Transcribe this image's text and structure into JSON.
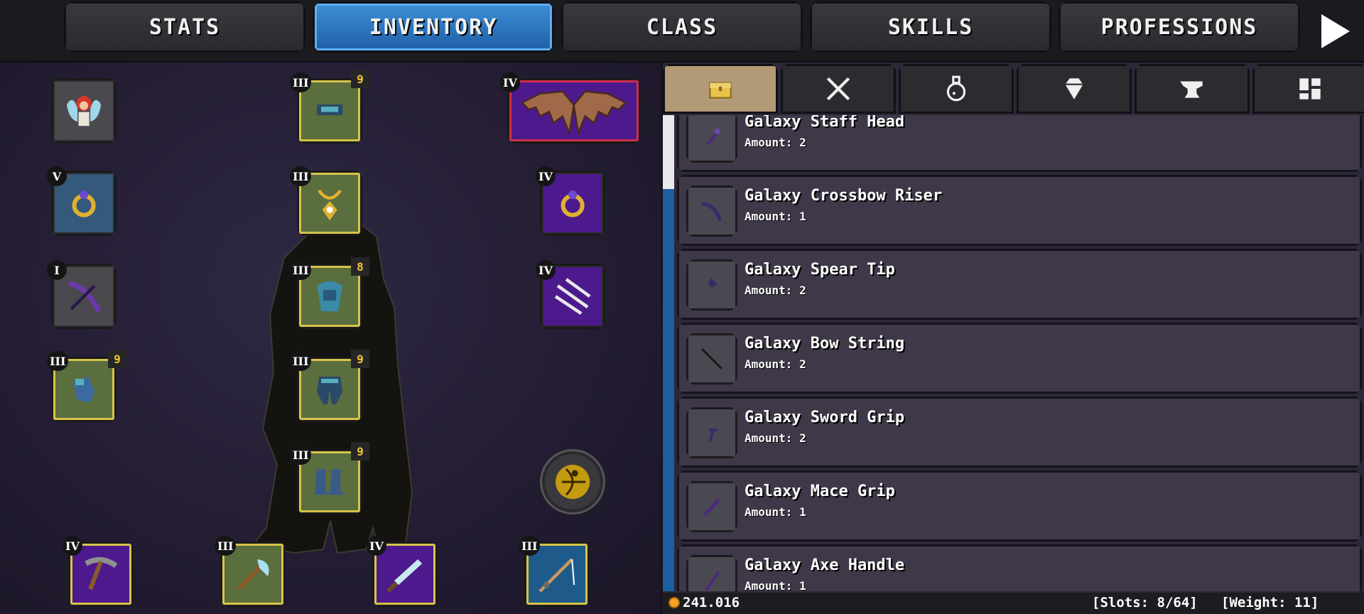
{
  "top_tabs": {
    "stats": "STATS",
    "inventory": "INVENTORY",
    "class": "CLASS",
    "skills": "SKILLS",
    "professions": "PROFESSIONS"
  },
  "equipment": {
    "head_top": {
      "tier": "III",
      "count": "9"
    },
    "wings": {
      "tier": "IV"
    },
    "ring_left": {
      "tier": "V"
    },
    "amulet": {
      "tier": "III"
    },
    "ring_right": {
      "tier": "IV"
    },
    "crossbow": {
      "tier": "I"
    },
    "chest": {
      "tier": "III",
      "count": "8"
    },
    "arrows": {
      "tier": "IV"
    },
    "gloves": {
      "tier": "III",
      "count": "9"
    },
    "legs": {
      "tier": "III",
      "count": "9"
    },
    "boots": {
      "tier": "III",
      "count": "9"
    },
    "pickaxe": {
      "tier": "IV"
    },
    "axe": {
      "tier": "III"
    },
    "knife": {
      "tier": "IV"
    },
    "fishing_rod": {
      "tier": "III"
    }
  },
  "category_tabs": [
    "chest-icon",
    "crossed-swords-icon",
    "potion-icon",
    "gem-icon",
    "anvil-icon",
    "grid-icon"
  ],
  "items": [
    {
      "name": "Galaxy Staff Head",
      "amount": "Amount: 2"
    },
    {
      "name": "Galaxy Crossbow Riser",
      "amount": "Amount: 1"
    },
    {
      "name": "Galaxy Spear Tip",
      "amount": "Amount: 2"
    },
    {
      "name": "Galaxy Bow String",
      "amount": "Amount: 2"
    },
    {
      "name": "Galaxy Sword Grip",
      "amount": "Amount: 2"
    },
    {
      "name": "Galaxy Mace Grip",
      "amount": "Amount: 1"
    },
    {
      "name": "Galaxy Axe Handle",
      "amount": "Amount: 1"
    }
  ],
  "status": {
    "gold": "241.016",
    "slots": "[Slots: 8/64]",
    "weight": "[Weight: 11]"
  },
  "colors": {
    "active_tab": "#2f7fcf",
    "rare_slot": "#5a6e3e",
    "epic_slot": "#4c1a8c",
    "gold_border": "#d8c34a"
  }
}
